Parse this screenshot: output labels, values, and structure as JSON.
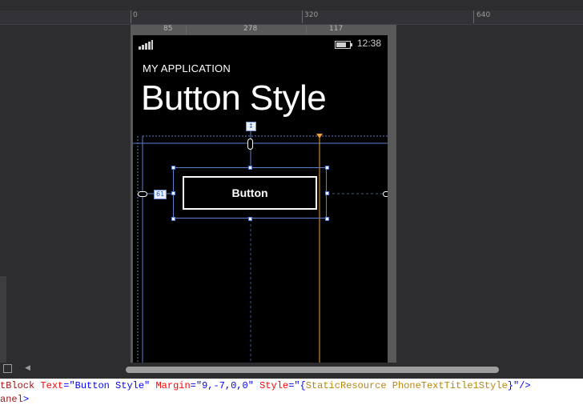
{
  "ruler": {
    "ticks": [
      "0",
      "320",
      "640"
    ]
  },
  "dimensions": {
    "left": "85",
    "width": "278",
    "right": "117"
  },
  "phone": {
    "clock": "12:38",
    "app_title": "MY APPLICATION",
    "page_title": "Button Style",
    "button_label": "Button",
    "margin_badge": "61"
  },
  "code": {
    "line1": {
      "tag": "tBlock",
      "attr1": "Text",
      "val1": "\"Button Style\"",
      "attr2": "Margin",
      "val2": "\"9,-7,0,0\"",
      "attr3": "Style",
      "val3_open": "\"{",
      "resource_keyword": "StaticResource",
      "resource_name": "PhoneTextTitle1Style",
      "val3_close": "}\"",
      "end": "/>"
    },
    "line2": {
      "tag": "anel",
      "end": ">"
    }
  },
  "colors": {
    "accent_orange": "#f0a030",
    "guide_blue": "#5b7fd1"
  }
}
